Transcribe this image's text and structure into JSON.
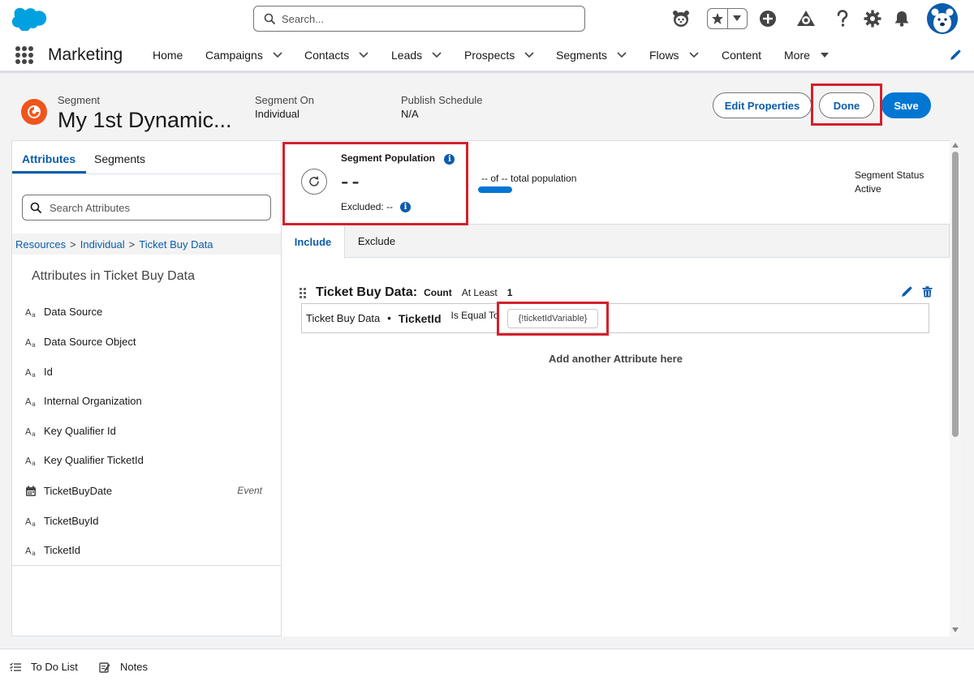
{
  "header": {
    "search_placeholder": "Search..."
  },
  "nav": {
    "app_name": "Marketing",
    "items": [
      {
        "label": "Home"
      },
      {
        "label": "Campaigns"
      },
      {
        "label": "Contacts"
      },
      {
        "label": "Leads"
      },
      {
        "label": "Prospects"
      },
      {
        "label": "Segments"
      },
      {
        "label": "Flows"
      },
      {
        "label": "Content"
      },
      {
        "label": "More"
      }
    ]
  },
  "record": {
    "object_label": "Segment",
    "title": "My 1st Dynamic...",
    "segment_on_label": "Segment On",
    "segment_on_value": "Individual",
    "publish_schedule_label": "Publish Schedule",
    "publish_schedule_value": "N/A",
    "edit_properties_label": "Edit Properties",
    "done_label": "Done",
    "save_label": "Save"
  },
  "left_panel": {
    "tabs": [
      {
        "label": "Attributes"
      },
      {
        "label": "Segments"
      }
    ],
    "search_placeholder": "Search Attributes",
    "breadcrumb": [
      {
        "label": "Resources"
      },
      {
        "label": "Individual"
      },
      {
        "label": "Ticket Buy Data"
      }
    ],
    "breadcrumb_sep": ">",
    "heading": "Attributes in Ticket Buy Data",
    "attributes": [
      {
        "label": "Data Source",
        "icon": "text-type-icon"
      },
      {
        "label": "Data Source Object",
        "icon": "text-type-icon"
      },
      {
        "label": "Id",
        "icon": "text-type-icon"
      },
      {
        "label": "Internal Organization",
        "icon": "text-type-icon"
      },
      {
        "label": "Key Qualifier Id",
        "icon": "text-type-icon"
      },
      {
        "label": "Key Qualifier TicketId",
        "icon": "text-type-icon"
      },
      {
        "label": "TicketBuyDate",
        "icon": "calendar-icon",
        "badge": "Event"
      },
      {
        "label": "TicketBuyId",
        "icon": "text-type-icon"
      },
      {
        "label": "TicketId",
        "icon": "text-type-icon"
      }
    ]
  },
  "population": {
    "title": "Segment Population",
    "value": "--",
    "excluded": "Excluded: --",
    "total_text": "-- of -- total population",
    "progress_percent": 100,
    "status_label": "Segment Status",
    "status_value": "Active"
  },
  "rule_tabs": [
    {
      "label": "Include"
    },
    {
      "label": "Exclude"
    }
  ],
  "rule": {
    "object": "Ticket Buy Data:",
    "count_label": "Count",
    "operator_label": "At Least",
    "count_value": "1",
    "row_object": "Ticket Buy Data",
    "row_dot": "•",
    "row_field": "TicketId",
    "row_operator": "Is Equal To",
    "row_value": "{!ticketIdVariable}"
  },
  "add_attribute_label": "Add another Attribute here",
  "utility_bar": {
    "items": [
      {
        "label": "To Do List"
      },
      {
        "label": "Notes"
      }
    ]
  },
  "colors": {
    "brand_blue": "#0176d3",
    "link_blue": "#0b5cab",
    "segment_orange": "#f1541b",
    "highlight_red": "#d4202c"
  }
}
